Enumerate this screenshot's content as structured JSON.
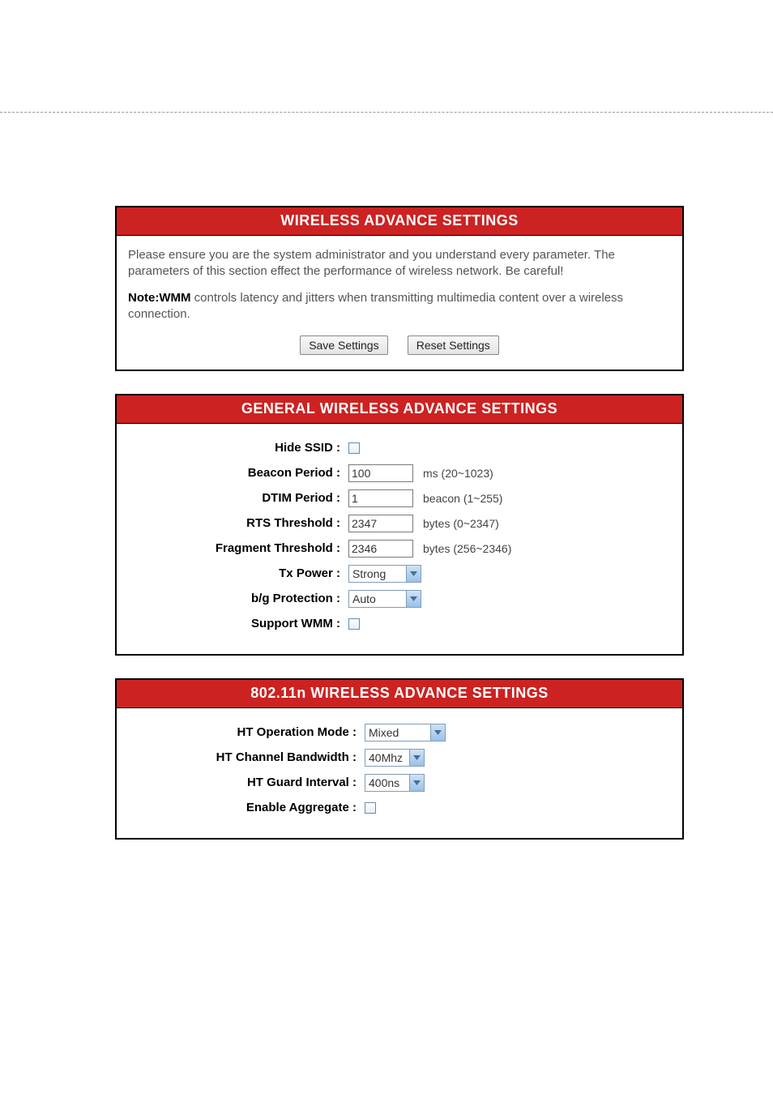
{
  "panel1": {
    "title": "WIRELESS ADVANCE SETTINGS",
    "intro": "Please ensure you are the system administrator and you understand every parameter. The parameters of this section effect the performance of wireless network. Be careful!",
    "note_label": "Note:WMM",
    "note_text": " controls latency and jitters when transmitting multimedia content over a wireless connection.",
    "save_btn": "Save Settings",
    "reset_btn": "Reset Settings"
  },
  "panel2": {
    "title": "GENERAL WIRELESS ADVANCE SETTINGS",
    "rows": {
      "hide_ssid": {
        "label": "Hide SSID :"
      },
      "beacon_period": {
        "label": "Beacon Period :",
        "value": "100",
        "suffix": "ms (20~1023)"
      },
      "dtim_period": {
        "label": "DTIM Period :",
        "value": "1",
        "suffix": "beacon (1~255)"
      },
      "rts_threshold": {
        "label": "RTS Threshold :",
        "value": "2347",
        "suffix": "bytes (0~2347)"
      },
      "fragment_threshold": {
        "label": "Fragment Threshold :",
        "value": "2346",
        "suffix": "bytes (256~2346)"
      },
      "tx_power": {
        "label": "Tx Power :",
        "value": "Strong"
      },
      "bg_protection": {
        "label": "b/g Protection :",
        "value": "Auto"
      },
      "support_wmm": {
        "label": "Support WMM :"
      }
    }
  },
  "panel3": {
    "title": "802.11n WIRELESS ADVANCE SETTINGS",
    "rows": {
      "ht_op_mode": {
        "label": "HT Operation Mode :",
        "value": "Mixed"
      },
      "ht_channel_bw": {
        "label": "HT Channel Bandwidth :",
        "value": "40Mhz"
      },
      "ht_guard_interval": {
        "label": "HT Guard Interval :",
        "value": "400ns"
      },
      "enable_aggregate": {
        "label": "Enable Aggregate :"
      }
    }
  }
}
